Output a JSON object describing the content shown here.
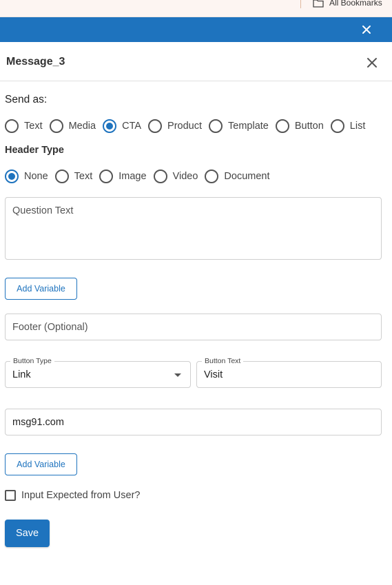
{
  "browser": {
    "bookmarks_label": "All Bookmarks"
  },
  "panel": {
    "title": "Message_3"
  },
  "send_as": {
    "label": "Send as:",
    "options": [
      "Text",
      "Media",
      "CTA",
      "Product",
      "Template",
      "Button",
      "List"
    ],
    "selected": "CTA"
  },
  "header_type": {
    "label": "Header Type",
    "options": [
      "None",
      "Text",
      "Image",
      "Video",
      "Document"
    ],
    "selected": "None"
  },
  "question": {
    "placeholder": "Question Text"
  },
  "add_variable_1": "Add Variable",
  "footer": {
    "placeholder": "Footer (Optional)"
  },
  "button_type": {
    "label": "Button Type",
    "value": "Link"
  },
  "button_text": {
    "label": "Button Text",
    "value": "Visit"
  },
  "url": {
    "value": "msg91.com"
  },
  "add_variable_2": "Add Variable",
  "input_expected": {
    "label": "Input Expected from User?",
    "checked": false
  },
  "save_label": "Save",
  "colors": {
    "accent": "#1e73be",
    "bookmark_bar": "#fdf5f2"
  }
}
